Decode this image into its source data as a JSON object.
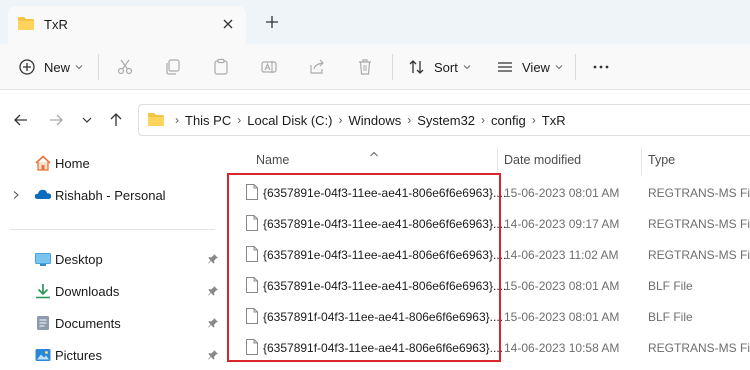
{
  "tab": {
    "title": "TxR",
    "new_tab_symbol": "+"
  },
  "commandbar": {
    "new_label": "New",
    "sort_label": "Sort",
    "view_label": "View",
    "more_label": "···",
    "icons": [
      "plus-circle-icon",
      "cut-icon",
      "copy-icon",
      "paste-icon",
      "rename-icon",
      "share-icon",
      "delete-icon",
      "sort-icon",
      "view-icon",
      "more-icon"
    ]
  },
  "address": {
    "breadcrumbs": [
      "This PC",
      "Local Disk (C:)",
      "Windows",
      "System32",
      "config",
      "TxR"
    ]
  },
  "sidebar": {
    "items": [
      {
        "label": "Home",
        "icon": "home-icon"
      },
      {
        "label": "Rishabh - Personal",
        "icon": "onedrive-icon"
      },
      {
        "label": "Desktop",
        "icon": "desktop-icon"
      },
      {
        "label": "Downloads",
        "icon": "downloads-icon"
      },
      {
        "label": "Documents",
        "icon": "documents-icon"
      },
      {
        "label": "Pictures",
        "icon": "pictures-icon"
      }
    ]
  },
  "filelist": {
    "columns": {
      "name": "Name",
      "date": "Date modified",
      "type": "Type"
    },
    "rows": [
      {
        "name": "{6357891e-04f3-11ee-ae41-806e6f6e6963}....",
        "date": "15-06-2023 08:01 AM",
        "type": "REGTRANS-MS File"
      },
      {
        "name": "{6357891e-04f3-11ee-ae41-806e6f6e6963}....",
        "date": "14-06-2023 09:17 AM",
        "type": "REGTRANS-MS File"
      },
      {
        "name": "{6357891e-04f3-11ee-ae41-806e6f6e6963}....",
        "date": "14-06-2023 11:02 AM",
        "type": "REGTRANS-MS File"
      },
      {
        "name": "{6357891e-04f3-11ee-ae41-806e6f6e6963}....",
        "date": "15-06-2023 08:01 AM",
        "type": "BLF File"
      },
      {
        "name": "{6357891f-04f3-11ee-ae41-806e6f6e6963}....",
        "date": "15-06-2023 08:01 AM",
        "type": "BLF File"
      },
      {
        "name": "{6357891f-04f3-11ee-ae41-806e6f6e6963}....",
        "date": "14-06-2023 10:58 AM",
        "type": "REGTRANS-MS File"
      }
    ]
  },
  "colors": {
    "highlight": "#d9262b",
    "folder": "#f4c542",
    "accent": "#0067c0"
  }
}
